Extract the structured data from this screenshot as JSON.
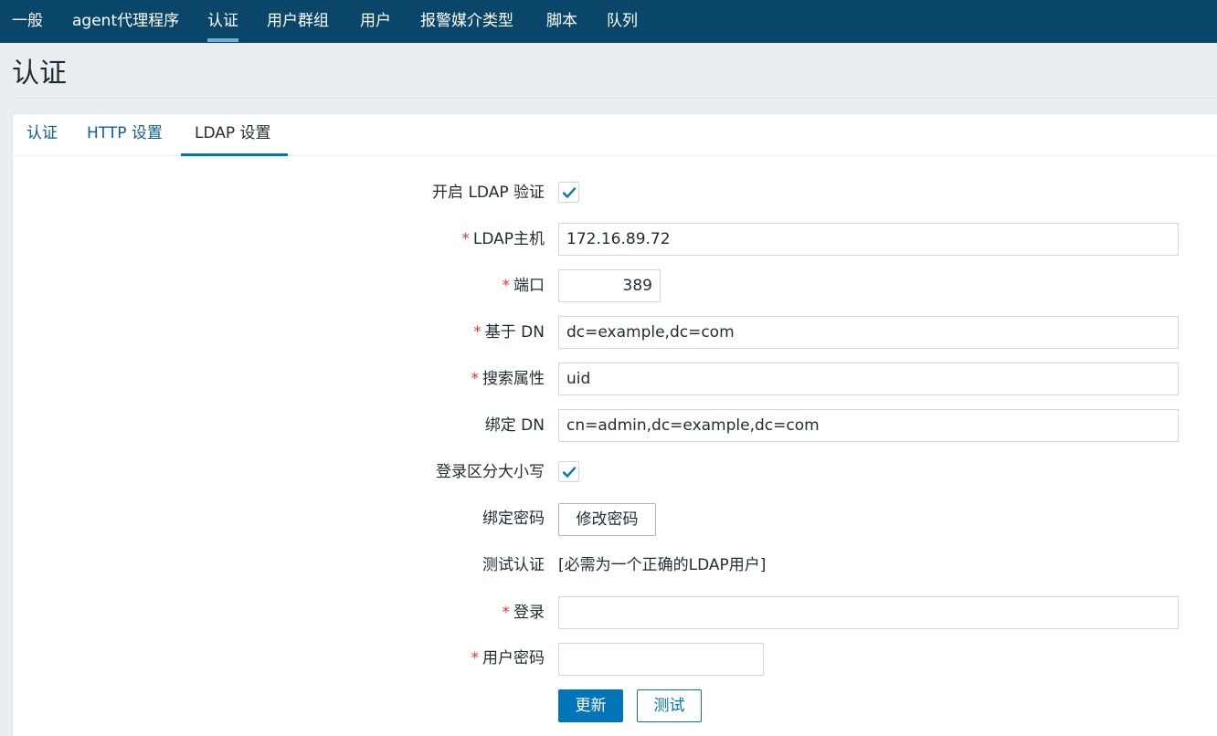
{
  "nav": {
    "items": [
      {
        "label": "一般"
      },
      {
        "label": "agent代理程序"
      },
      {
        "label": "认证"
      },
      {
        "label": "用户群组"
      },
      {
        "label": "用户"
      },
      {
        "label": "报警媒介类型"
      },
      {
        "label": "脚本"
      },
      {
        "label": "队列"
      }
    ],
    "active": "认证"
  },
  "page": {
    "title": "认证"
  },
  "tabs": [
    {
      "label": "认证"
    },
    {
      "label": "HTTP 设置"
    },
    {
      "label": "LDAP 设置"
    }
  ],
  "form": {
    "required_mark": "*",
    "enable_ldap": {
      "label": "开启 LDAP 验证",
      "checked": true
    },
    "ldap_host": {
      "label": "LDAP主机",
      "value": "172.16.89.72"
    },
    "port": {
      "label": "端口",
      "value": "389"
    },
    "base_dn": {
      "label": "基于 DN",
      "value": "dc=example,dc=com"
    },
    "search_attr": {
      "label": "搜索属性",
      "value": "uid"
    },
    "bind_dn": {
      "label": "绑定 DN",
      "value": "cn=admin,dc=example,dc=com"
    },
    "case_sensitive": {
      "label": "登录区分大小写",
      "checked": true
    },
    "bind_password": {
      "label": "绑定密码",
      "button": "修改密码"
    },
    "test_auth": {
      "label": "测试认证",
      "note": "[必需为一个正确的LDAP用户]"
    },
    "login": {
      "label": "登录",
      "value": ""
    },
    "user_password": {
      "label": "用户密码",
      "value": ""
    },
    "update_button": "更新",
    "test_button": "测试"
  },
  "colors": {
    "nav_bg": "#0a466a",
    "accent": "#0275b8",
    "required": "#e33734",
    "link": "#0f5f8f"
  }
}
